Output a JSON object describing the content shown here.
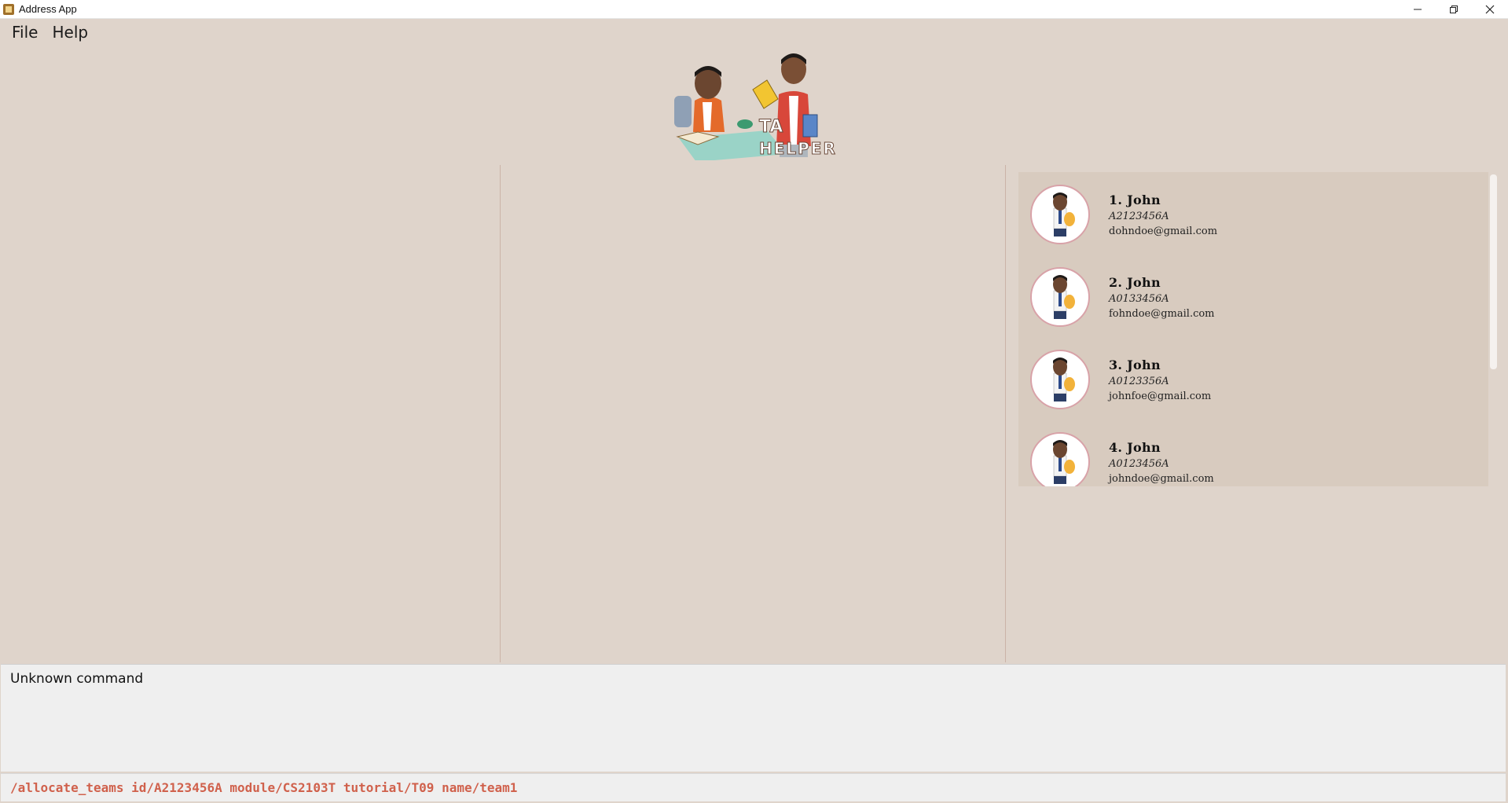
{
  "window": {
    "title": "Address App",
    "controls": [
      "minimize-icon",
      "restore-icon",
      "close-icon"
    ]
  },
  "menu": {
    "file": "File",
    "help": "Help"
  },
  "logo": {
    "text": "TA HELPER"
  },
  "persons": [
    {
      "index_name": "1.  John",
      "id": "A2123456A",
      "email": "dohndoe@gmail.com"
    },
    {
      "index_name": "2.  John",
      "id": "A0133456A",
      "email": "fohndoe@gmail.com"
    },
    {
      "index_name": "3.  John",
      "id": "A0123356A",
      "email": "johnfoe@gmail.com"
    },
    {
      "index_name": "4.  John",
      "id": "A0123456A",
      "email": "johndoe@gmail.com"
    }
  ],
  "result": {
    "message": "Unknown command"
  },
  "command": {
    "value": "/allocate_teams id/A2123456A module/CS2103T tutorial/T09 name/team1"
  },
  "colors": {
    "background": "#dfd4cb",
    "list_background": "#d8cbbf",
    "command_text": "#d0614c"
  }
}
